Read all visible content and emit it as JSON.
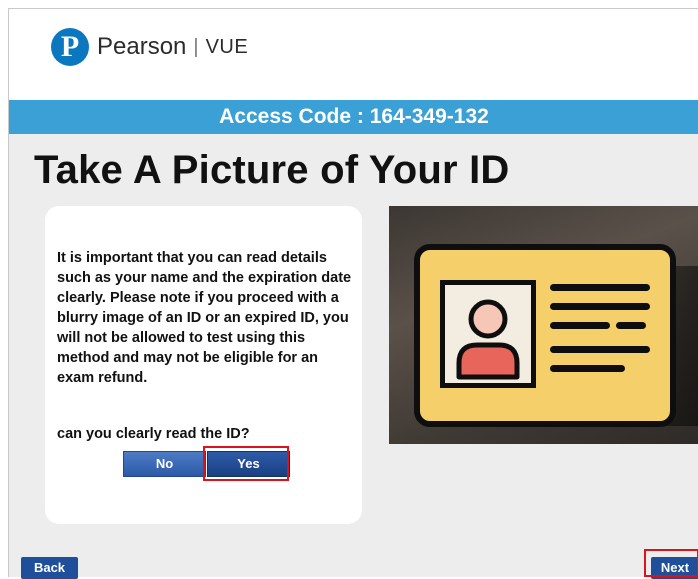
{
  "header": {
    "logo_letter": "P",
    "brand": "Pearson",
    "separator": "|",
    "product": "VUE"
  },
  "access_code": "Access Code : 164-349-132",
  "page_title": "Take A Picture of Your ID",
  "card": {
    "instructions": "It is important that you can read details such as your name and the expiration date clearly.  Please note if you proceed with a blurry image of an ID or an expired ID, you will not be allowed to test using this method and may not be eligible for an exam refund.",
    "question": "can you clearly read the ID?",
    "no_label": "No",
    "yes_label": "Yes"
  },
  "camera": {
    "preview_icon": "id-card-icon"
  },
  "footer": {
    "back_label": "Back",
    "next_label": "Next"
  },
  "colors": {
    "accent_bar": "#3aa0d6",
    "button_blue": "#1f4f9a",
    "highlight": "#d9141c",
    "id_card_yellow": "#f5cf6a",
    "avatar_skin": "#f6c7b6",
    "avatar_body": "#e8655c"
  }
}
